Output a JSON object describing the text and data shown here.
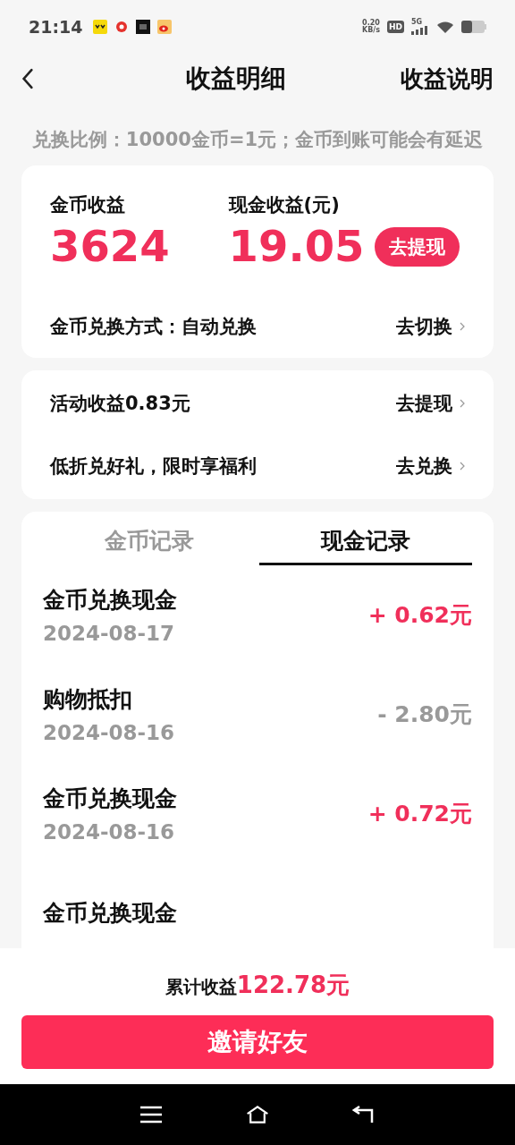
{
  "status_bar": {
    "time": "21:14",
    "speed_value": "0.20",
    "speed_unit": "KB/s",
    "hd": "HD",
    "network": "5G"
  },
  "header": {
    "title": "收益明细",
    "action": "收益说明"
  },
  "notice": "兑换比例：10000金币=1元；金币到账可能会有延迟",
  "earnings": {
    "coin_label": "金币收益",
    "coin_value": "3624",
    "cash_label": "现金收益(元)",
    "cash_value": "19.05",
    "withdraw": "去提现",
    "mode_label": "金币兑换方式：自动兑换",
    "mode_action": "去切换"
  },
  "promos": [
    {
      "label": "活动收益0.83元",
      "action": "去提现"
    },
    {
      "label": "低折兑好礼，限时享福利",
      "action": "去兑换"
    }
  ],
  "tabs": [
    {
      "label": "金币记录",
      "selected": false
    },
    {
      "label": "现金记录",
      "selected": true
    }
  ],
  "records": [
    {
      "title": "金币兑换现金",
      "date": "2024-08-17",
      "amount": "+ 0.62元",
      "kind": "income"
    },
    {
      "title": "购物抵扣",
      "date": "2024-08-16",
      "amount": "- 2.80元",
      "kind": "expense"
    },
    {
      "title": "金币兑换现金",
      "date": "2024-08-16",
      "amount": "+ 0.72元",
      "kind": "income"
    },
    {
      "title": "金币兑换现金"
    }
  ],
  "footer": {
    "total_label": "累计收益",
    "total_value": "122.78元",
    "invite": "邀请好友"
  }
}
